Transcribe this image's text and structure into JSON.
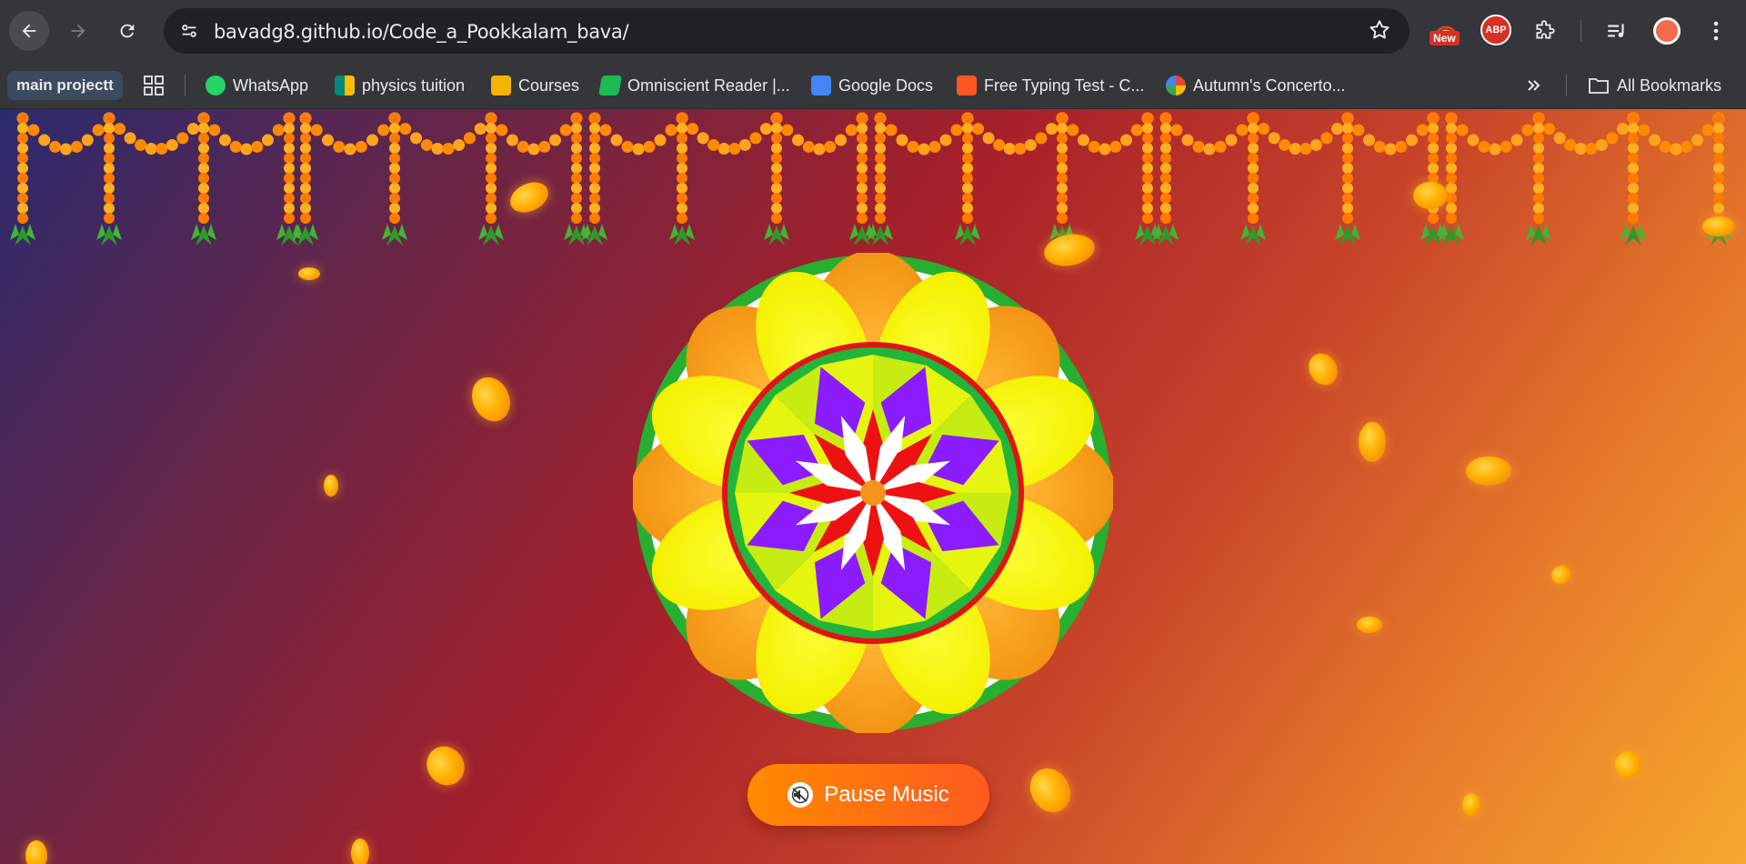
{
  "browser": {
    "url": "bavadg8.github.io/Code_a_Pookkalam_bava/",
    "extension_badge": "New",
    "adblock_label": "ABP"
  },
  "bookmarks": {
    "main_folder": "main projectt",
    "items": [
      {
        "label": "WhatsApp",
        "icon": "whatsapp-icon",
        "color": "#25d366"
      },
      {
        "label": "physics tuition",
        "icon": "google-meet-icon",
        "color": "#00897b"
      },
      {
        "label": "Courses",
        "icon": "classroom-icon",
        "color": "#f4b400"
      },
      {
        "label": "Omniscient Reader |...",
        "icon": "book-icon",
        "color": "#1db954"
      },
      {
        "label": "Google Docs",
        "icon": "docs-icon",
        "color": "#4285f4"
      },
      {
        "label": "Free Typing Test - C...",
        "icon": "chat-icon",
        "color": "#ff5722"
      },
      {
        "label": "Autumn's Concerto...",
        "icon": "google-icon",
        "color": "#4285f4"
      }
    ],
    "all_bookmarks": "All Bookmarks"
  },
  "page": {
    "music_button_label": "Pause Music",
    "colors": {
      "orange": "#f39c12",
      "yellow": "#ffff00",
      "red": "#e01010",
      "green": "#22b53a",
      "purple": "#8a1cff",
      "lime": "#d4f012"
    }
  }
}
